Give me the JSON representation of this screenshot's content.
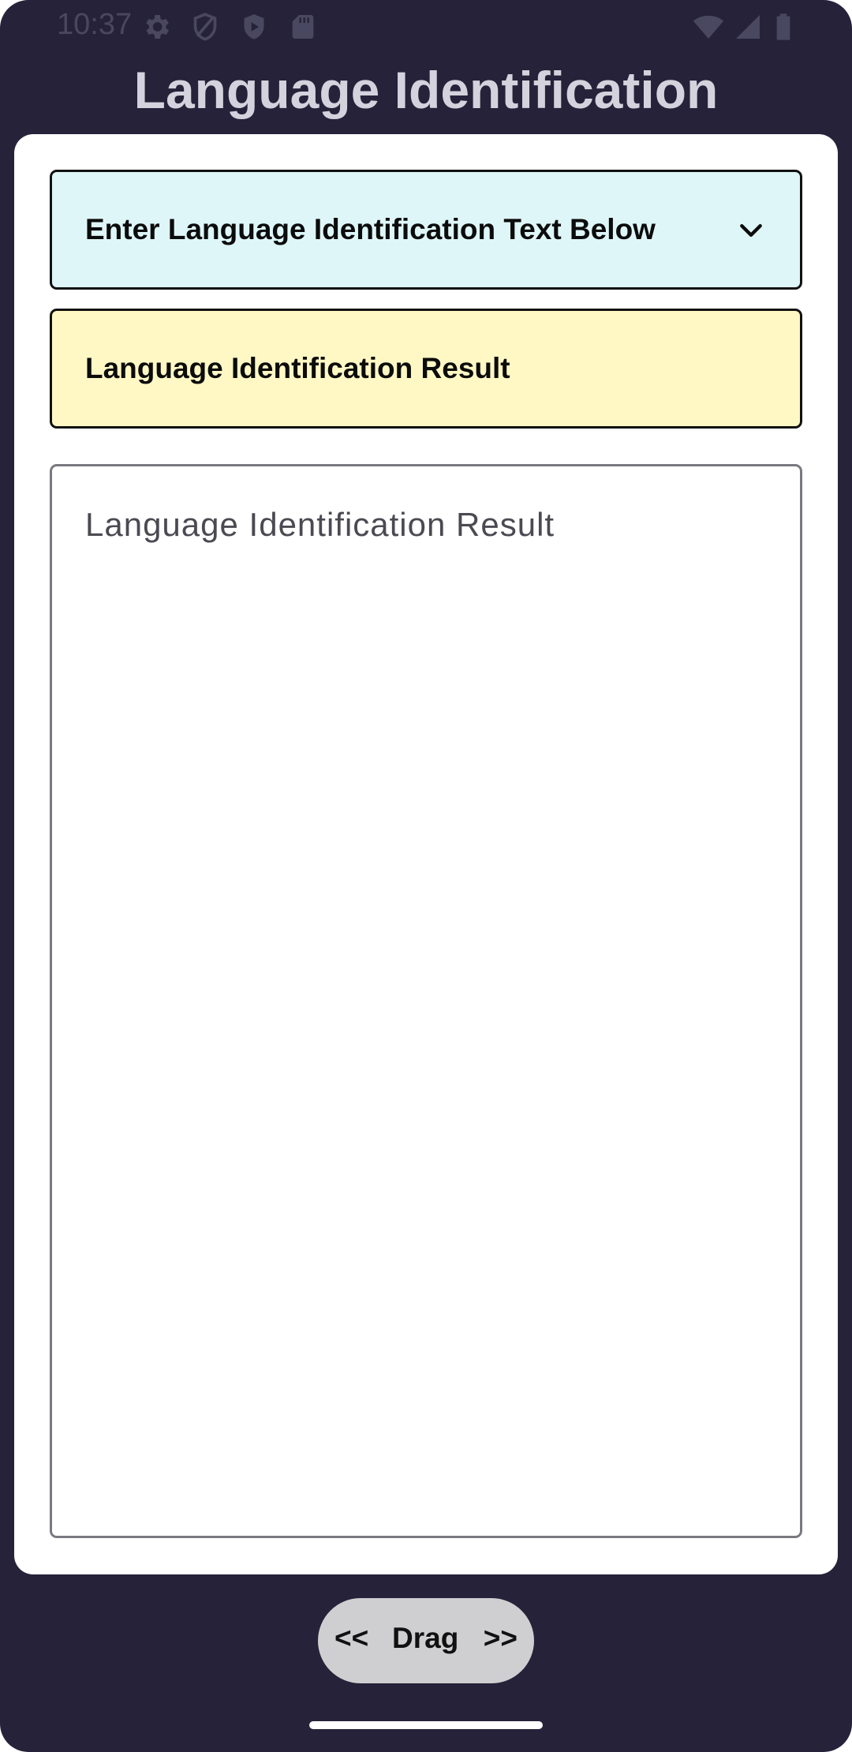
{
  "status_bar": {
    "time": "10:37",
    "left_icons": [
      "gear-icon",
      "shield-icon",
      "play-shield-icon",
      "sd-card-icon"
    ],
    "right_icons": [
      "wifi-icon",
      "cell-signal-icon",
      "battery-icon"
    ]
  },
  "app": {
    "title": "Language Identification"
  },
  "input_dropdown": {
    "label": "Enter Language Identification Text Below",
    "icon": "chevron-down-icon",
    "background": "#def6f8"
  },
  "result_header": {
    "label": "Language Identification Result",
    "background": "#fff8c4"
  },
  "result_field": {
    "placeholder": "Language Identification Result",
    "value": ""
  },
  "drag_handle": {
    "left": "<<",
    "label": "Drag",
    "right": ">>"
  },
  "colors": {
    "screen_background": "#25223a",
    "card_background": "#ffffff"
  }
}
